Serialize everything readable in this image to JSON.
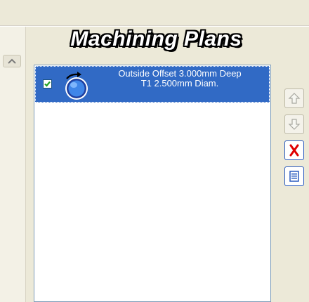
{
  "panel": {
    "title": "Machining Plans"
  },
  "plans": [
    {
      "checked": true,
      "icon": "outside-offset-toolpath-icon",
      "line1": "Outside Offset 3.000mm Deep",
      "line2": "T1 2.500mm Diam."
    }
  ],
  "side_buttons": [
    {
      "icon": "move-up-arrow-icon",
      "enabled": false
    },
    {
      "icon": "move-down-arrow-icon",
      "enabled": false
    },
    {
      "icon": "delete-x-icon",
      "enabled": true
    },
    {
      "icon": "properties-icon",
      "enabled": true
    }
  ],
  "colors": {
    "background": "#ece9d8",
    "selection": "#316ac5",
    "delete_red": "#e00000",
    "list_border": "#7f9db9"
  }
}
